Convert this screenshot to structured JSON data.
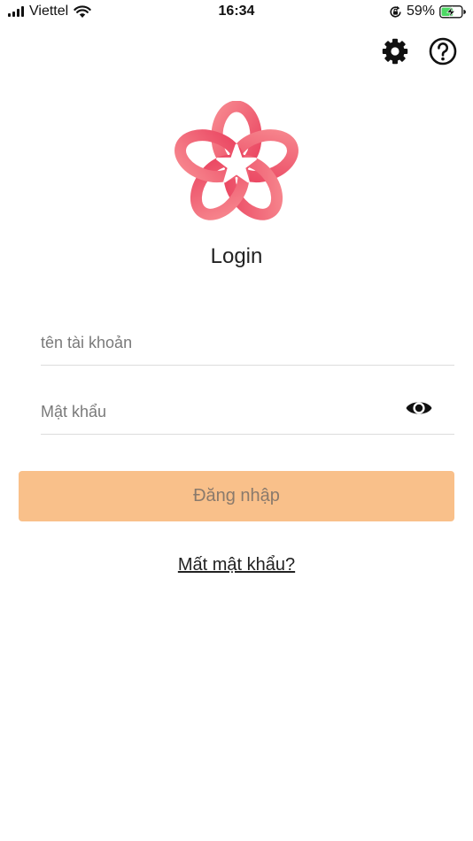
{
  "status_bar": {
    "carrier": "Viettel",
    "time": "16:34",
    "battery_percent": "59%",
    "battery_level": 0.59,
    "icons": [
      "signal-icon",
      "wifi-icon",
      "rotation-lock-icon",
      "battery-charging-icon"
    ]
  },
  "header": {
    "icons": [
      "settings-gear-icon",
      "help-icon"
    ]
  },
  "brand": {
    "logo": "flower-star-logo",
    "colors": {
      "logo_gradient_start": "#f7888f",
      "logo_gradient_end": "#ea4460"
    }
  },
  "login": {
    "title": "Login",
    "username_placeholder": "tên tài khoản",
    "username_value": "",
    "password_placeholder": "Mật khẩu",
    "password_value": "",
    "password_toggle_icon": "eye-icon",
    "submit_label": "Đăng nhập",
    "forgot_label": "Mất mật khẩu?",
    "colors": {
      "button_bg": "#f9c08a",
      "button_text": "#8a7a6c"
    }
  }
}
